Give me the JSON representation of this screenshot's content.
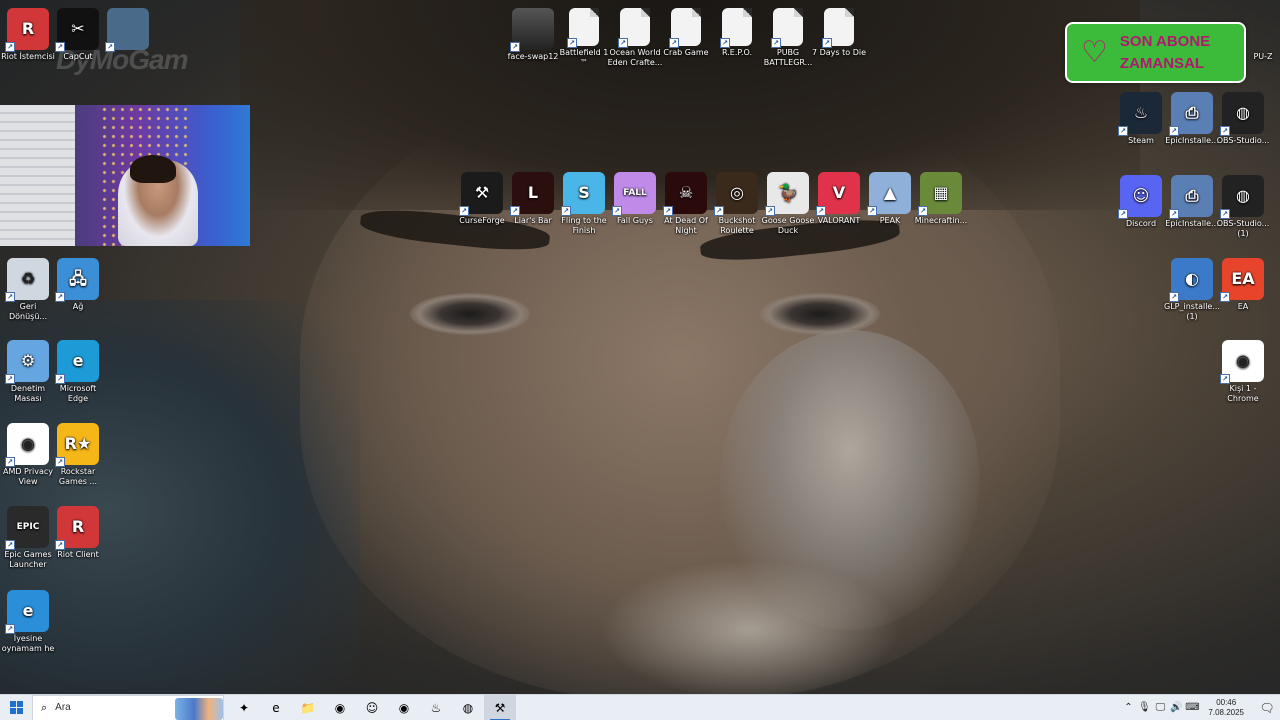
{
  "desktop": {
    "left_column": [
      {
        "label": "Riot İstemcisi",
        "icon": "riot-icon",
        "color": "#d13639",
        "glyph": "R"
      },
      {
        "label": "CapCut",
        "icon": "capcut-icon",
        "color": "#111111",
        "glyph": "✂"
      },
      {
        "label": "",
        "icon": "media-thumbnail-icon",
        "color": "#4a6a8a",
        "glyph": ""
      },
      {
        "label": "Geri Dönüşü...",
        "icon": "recycle-bin-icon",
        "color": "#cfd8e0",
        "glyph": "♻"
      },
      {
        "label": "Ağ",
        "icon": "network-icon",
        "color": "#3b8fd6",
        "glyph": "🖧"
      },
      {
        "label": "Denetim Masası",
        "icon": "control-panel-icon",
        "color": "#66a6e0",
        "glyph": "⚙"
      },
      {
        "label": "Microsoft Edge",
        "icon": "edge-icon",
        "color": "#1d9bd6",
        "glyph": "e"
      },
      {
        "label": "AMD Privacy View",
        "icon": "amd-privacy-icon",
        "color": "#ffffff",
        "glyph": "◉"
      },
      {
        "label": "Rockstar Games ...",
        "icon": "rockstar-icon",
        "color": "#f5b617",
        "glyph": "R★"
      },
      {
        "label": "Epic Games Launcher",
        "icon": "epic-games-icon",
        "color": "#2a2a2a",
        "glyph": "EPIC"
      },
      {
        "label": "Riot Client",
        "icon": "riot-client-icon",
        "color": "#d13639",
        "glyph": "R"
      },
      {
        "label": "İyesine oynamam he",
        "icon": "internet-explorer-icon",
        "color": "#2a8fd8",
        "glyph": "e"
      }
    ],
    "top_row": [
      {
        "label": "face-swap12",
        "icon": "face-swap-icon",
        "type": "image"
      },
      {
        "label": "Battlefield 1 ™",
        "icon": "file-icon",
        "type": "file"
      },
      {
        "label": "Ocean World Eden Crafte...",
        "icon": "file-icon",
        "type": "file"
      },
      {
        "label": "Crab Game",
        "icon": "file-icon",
        "type": "file"
      },
      {
        "label": "R.E.P.O.",
        "icon": "file-icon",
        "type": "file"
      },
      {
        "label": "PUBG BATTLEGR...",
        "icon": "file-icon",
        "type": "file"
      },
      {
        "label": "7 Days to Die",
        "icon": "file-icon",
        "type": "file"
      }
    ],
    "games_row": [
      {
        "label": "CurseForge",
        "icon": "curseforge-icon",
        "color": "#1b1b1b",
        "glyph": "⚒"
      },
      {
        "label": "Liar's Bar",
        "icon": "liars-bar-icon",
        "color": "#2b0e0e",
        "glyph": "L"
      },
      {
        "label": "Fling to the Finish",
        "icon": "fling-icon",
        "color": "#4ab6e8",
        "glyph": "S"
      },
      {
        "label": "Fall Guys",
        "icon": "fall-guys-icon",
        "color": "#c08ae8",
        "glyph": "FALL"
      },
      {
        "label": "At Dead Of Night",
        "icon": "at-dead-of-night-icon",
        "color": "#2a0a0a",
        "glyph": "☠"
      },
      {
        "label": "Buckshot Roulette",
        "icon": "buckshot-roulette-icon",
        "color": "#3a2a1c",
        "glyph": "◎"
      },
      {
        "label": "Goose Goose Duck",
        "icon": "goose-goose-duck-icon",
        "color": "#e8e8e8",
        "glyph": "🦆"
      },
      {
        "label": "VALORANT",
        "icon": "valorant-icon",
        "color": "#e0324b",
        "glyph": "V"
      },
      {
        "label": "PEAK",
        "icon": "peak-icon",
        "color": "#8fb0d8",
        "glyph": "▲"
      },
      {
        "label": "Minecraftin...",
        "icon": "minecraft-icon",
        "color": "#6a8a3a",
        "glyph": "▦"
      }
    ],
    "right_column": [
      {
        "label": "Steam",
        "icon": "steam-icon",
        "color": "#1b2838",
        "glyph": "♨"
      },
      {
        "label": "EpicInstalle...",
        "icon": "installer-icon",
        "color": "#5a7fb5",
        "glyph": "⎙"
      },
      {
        "label": "OBS-Studio...",
        "icon": "obs-icon",
        "color": "#222222",
        "glyph": "◍"
      },
      {
        "label": "Discord",
        "icon": "discord-icon",
        "color": "#5865f2",
        "glyph": "☺"
      },
      {
        "label": "EpicInstalle...",
        "icon": "installer-icon",
        "color": "#5a7fb5",
        "glyph": "⎙"
      },
      {
        "label": "OBS-Studio... (1)",
        "icon": "obs-icon",
        "color": "#222222",
        "glyph": "◍"
      },
      {
        "label": "GLP_installe... (1)",
        "icon": "glp-installer-icon",
        "color": "#3a7ac8",
        "glyph": "◐"
      },
      {
        "label": "EA",
        "icon": "ea-icon",
        "color": "#e8442b",
        "glyph": "EA"
      },
      {
        "label": "Kişi 1 - Chrome",
        "icon": "chrome-icon",
        "color": "#ffffff",
        "glyph": "◉"
      }
    ],
    "right_partial_label": "PU-Z"
  },
  "overlay": {
    "alert_line1": "SON ABONE",
    "alert_line2": "ZAMANSAL",
    "watermark": "DyMoGam",
    "alert_bg": "#3cba3a",
    "alert_text_color": "#b01a6e"
  },
  "taskbar": {
    "search_placeholder": "Ara",
    "apps": [
      {
        "name": "copilot-icon",
        "glyph": "✦"
      },
      {
        "name": "edge-icon",
        "glyph": "e"
      },
      {
        "name": "file-explorer-icon",
        "glyph": "📁"
      },
      {
        "name": "chrome-icon",
        "glyph": "◉"
      },
      {
        "name": "discord-icon",
        "glyph": "☺"
      },
      {
        "name": "chrome-profile-icon",
        "glyph": "◉"
      },
      {
        "name": "steam-icon",
        "glyph": "♨"
      },
      {
        "name": "obs-icon",
        "glyph": "◍"
      },
      {
        "name": "curseforge-icon",
        "glyph": "⚒"
      }
    ],
    "time": "00:46",
    "date": "7.08.2025"
  }
}
